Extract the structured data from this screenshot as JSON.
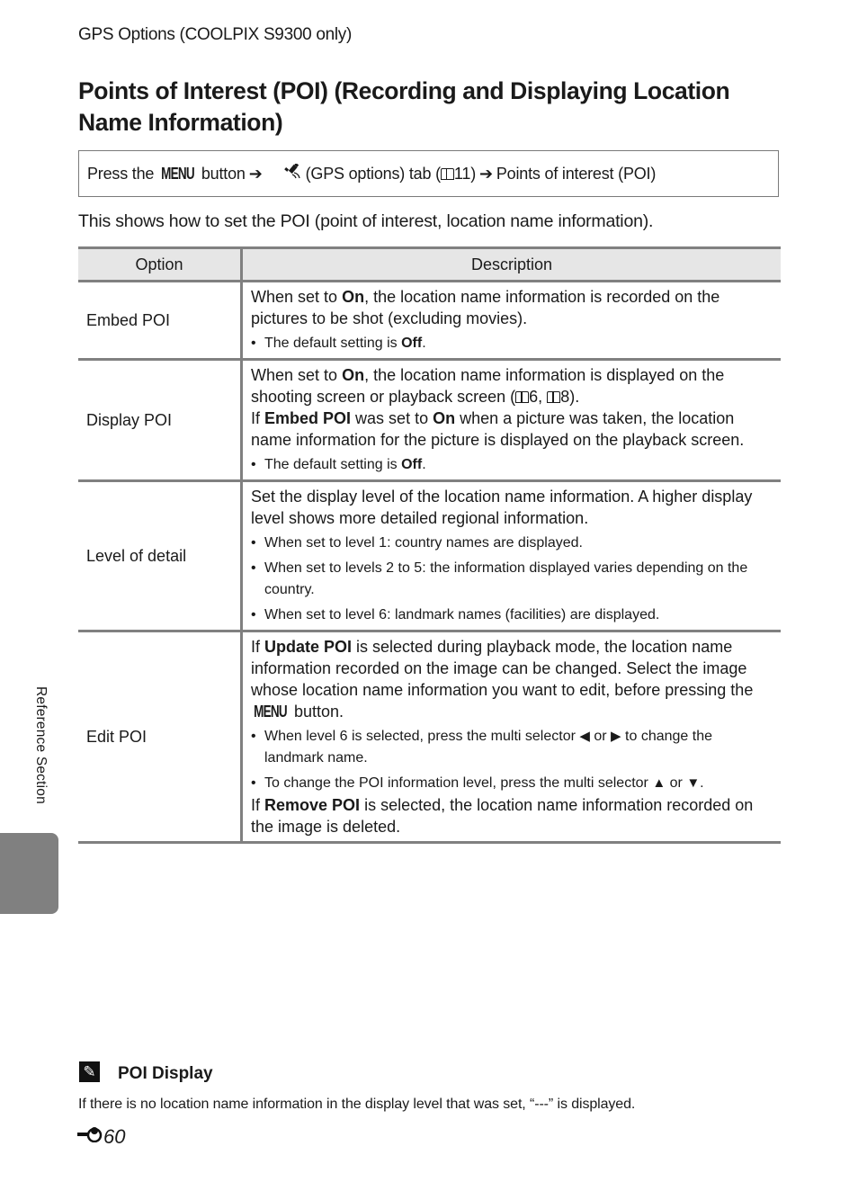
{
  "running_head": "GPS Options (COOLPIX S9300 only)",
  "title": "Points of Interest (POI) (Recording and Displaying Location Name Information)",
  "nav_path": {
    "prefix": "Press the ",
    "menu_label": "MENU",
    "button_text": " button",
    "arrow": "➔",
    "gps_icon": "satellite-icon",
    "tab_text": " (GPS options) tab (",
    "page_ref": "11",
    "close_paren": ")",
    "destination": "Points of interest (POI)"
  },
  "intro": "This shows how to set the POI (point of interest, location name information).",
  "table": {
    "headers": [
      "Option",
      "Description"
    ],
    "rows": [
      {
        "option": "Embed POI",
        "desc": {
          "p1_a": "When set to ",
          "p1_b": "On",
          "p1_c": ", the location name information is recorded on the pictures to be shot (excluding movies).",
          "bullet_a": "The default setting is ",
          "bullet_b": "Off",
          "bullet_c": "."
        }
      },
      {
        "option": "Display POI",
        "desc": {
          "p1_a": "When set to ",
          "p1_b": "On",
          "p1_c": ", the location name information is displayed on the shooting screen or playback screen (",
          "ref1": "6",
          "sep": ", ",
          "ref2": "8",
          "end": ").",
          "p2_a": "If ",
          "p2_b": "Embed POI",
          "p2_c": " was set to ",
          "p2_d": "On",
          "p2_e": " when a picture was taken, the location name information for the picture is displayed on the playback screen.",
          "bullet_a": "The default setting is ",
          "bullet_b": "Off",
          "bullet_c": "."
        }
      },
      {
        "option": "Level of detail",
        "desc": {
          "p1": "Set the display level of the location name information. A higher display level shows more detailed regional information.",
          "bullets": [
            "When set to level 1: country names are displayed.",
            "When set to levels 2 to 5: the information displayed varies depending on the country.",
            "When set to level 6: landmark names (facilities) are displayed."
          ]
        }
      },
      {
        "option": "Edit POI",
        "desc": {
          "p1_a": "If ",
          "p1_b": "Update POI",
          "p1_c": " is selected during playback mode, the location name information recorded on the image can be changed. Select the image whose location name information you want to edit, before pressing the ",
          "p1_menu": "MENU",
          "p1_d": " button.",
          "b1_a": "When level 6 is selected, press the multi selector ",
          "b1_left": "◀",
          "b1_or": " or ",
          "b1_right": "▶",
          "b1_b": " to change the landmark name.",
          "b2_a": "To change the POI information level, press the multi selector ",
          "b2_up": "▲",
          "b2_or": " or ",
          "b2_down": "▼",
          "b2_b": ".",
          "p2_a": "If ",
          "p2_b": "Remove POI",
          "p2_c": " is selected, the location name information recorded on the image is deleted."
        }
      }
    ]
  },
  "side_label": "Reference Section",
  "note": {
    "icon": "pencil-note-icon",
    "title": "POI Display",
    "text": "If there is no location name information in the display level that was set, “---” is displayed."
  },
  "page_number": {
    "prefix_icon": "reference-section-icon",
    "number": "60"
  },
  "colors": {
    "table_border": "#808080",
    "header_bg": "#e6e6e6",
    "side_tab": "#808080"
  }
}
